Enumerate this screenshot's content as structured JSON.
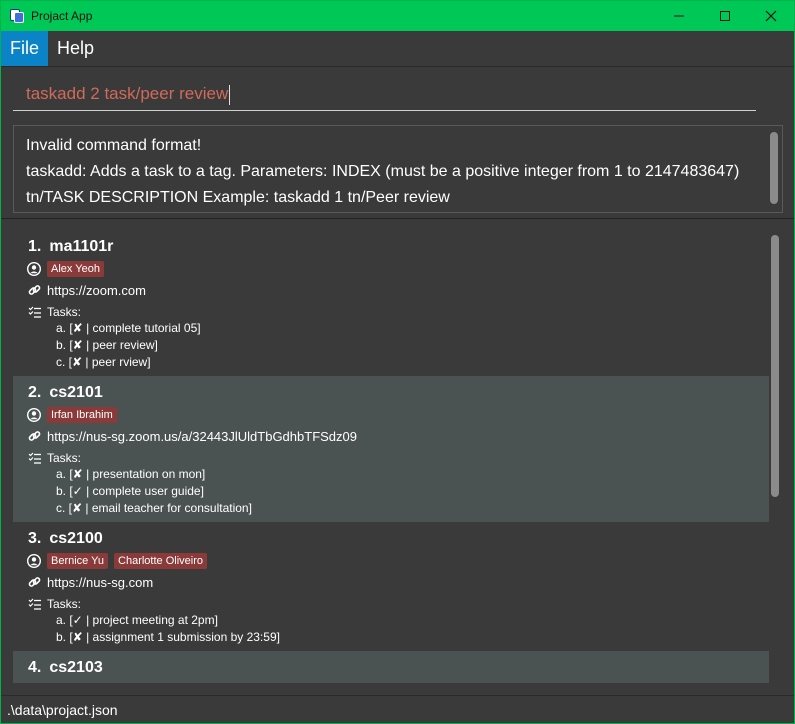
{
  "window": {
    "title": "Projact App"
  },
  "menu": {
    "file": "File",
    "help": "Help"
  },
  "command": {
    "value": "taskadd 2 task/peer review"
  },
  "result": {
    "line1": "Invalid command format!",
    "line2": "taskadd: Adds a task to a tag. Parameters: INDEX (must be a positive integer from 1 to 2147483647)",
    "line3": "tn/TASK DESCRIPTION Example: taskadd 1 tn/Peer review"
  },
  "cards": [
    {
      "index": "1.",
      "name": "ma1101r",
      "contacts": [
        "Alex Yeoh"
      ],
      "link": "https://zoom.com",
      "tasks_label": "Tasks:",
      "tasks": [
        "a. [✘ | complete tutorial 05]",
        "b. [✘ | peer review]",
        "c. [✘ | peer rview]"
      ]
    },
    {
      "index": "2.",
      "name": "cs2101",
      "contacts": [
        "Irfan Ibrahim"
      ],
      "link": "https://nus-sg.zoom.us/a/32443JlUldTbGdhbTFSdz09",
      "tasks_label": "Tasks:",
      "tasks": [
        "a. [✘ | presentation on mon]",
        "b. [✓ | complete user guide]",
        "c. [✘ | email teacher for consultation]"
      ]
    },
    {
      "index": "3.",
      "name": "cs2100",
      "contacts": [
        "Bernice Yu",
        "Charlotte Oliveiro"
      ],
      "link": "https://nus-sg.com",
      "tasks_label": "Tasks:",
      "tasks": [
        "a. [✓ | project meeting at 2pm]",
        "b. [✘ | assignment 1 submission by 23:59]"
      ]
    },
    {
      "index": "4.",
      "name": "cs2103"
    }
  ],
  "status": {
    "path": ".\\data\\projact.json"
  },
  "colors": {
    "titlebar": "#00c857",
    "accent": "#0b84c7",
    "tag": "#8b3a3a",
    "command_text": "#d06a5a"
  }
}
